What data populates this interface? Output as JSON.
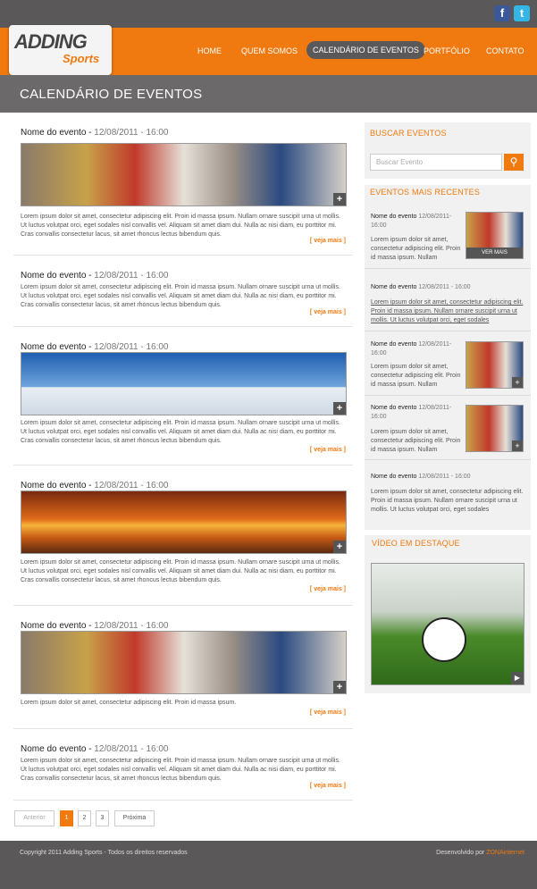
{
  "social": {
    "facebook": "f",
    "twitter": "t"
  },
  "brand": {
    "line1": "ADDING",
    "line2": "Sports"
  },
  "nav": {
    "home": "HOME",
    "quem": "QUEM SOMOS",
    "calendario": "CALENDÁRIO DE EVENTOS",
    "portfolio": "PORTFÓLIO",
    "contato": "CONTATO"
  },
  "page_title": "CALENDÁRIO DE EVENTOS",
  "events": [
    {
      "name": "Nome do evento - ",
      "date": "12/08/2011 - 16:00",
      "text": "Lorem ipsum dolor sit amet, consectetur adipiscing elit. Proin id massa ipsum. Nullam ornare suscipit urna ut mollis. Ut luctus volutpat orci, eget sodales nisl convallis vel. Aliquam sit amet diam dui. Nulla ac nisi diam, eu porttitor mi. Cras convallis consectetur lacus, sit amet rhoncus lectus bibendum quis.",
      "more": "[ veja mais ]"
    },
    {
      "name": "Nome do evento - ",
      "date": "12/08/2011 - 16:00",
      "text": "Lorem ipsum dolor sit amet, consectetur adipiscing elit. Proin id massa ipsum. Nullam ornare suscipit urna ut mollis. Ut luctus volutpat orci, eget sodales nisl convallis vel. Aliquam sit amet diam dui. Nulla ac nisi diam, eu porttitor mi. Cras convallis consectetur lacus, sit amet rhoncus lectus bibendum quis.",
      "more": "[ veja mais ]"
    },
    {
      "name": "Nome do evento - ",
      "date": "12/08/2011 - 16:00",
      "text": "Lorem ipsum dolor sit amet, consectetur adipiscing elit. Proin id massa ipsum. Nullam ornare suscipit urna ut mollis. Ut luctus volutpat orci, eget sodales nisl convallis vel. Aliquam sit amet diam dui. Nulla ac nisi diam, eu porttitor mi. Cras convallis consectetur lacus, sit amet rhoncus lectus bibendum quis.",
      "more": "[ veja mais ]"
    },
    {
      "name": "Nome do evento - ",
      "date": "12/08/2011 - 16:00",
      "text": "Lorem ipsum dolor sit amet, consectetur adipiscing elit. Proin id massa ipsum. Nullam ornare suscipit urna ut mollis. Ut luctus volutpat orci, eget sodales nisl convallis vel. Aliquam sit amet diam dui. Nulla ac nisi diam, eu porttitor mi. Cras convallis consectetur lacus, sit amet rhoncus lectus bibendum quis.",
      "more": "[ veja mais ]"
    },
    {
      "name": "Nome do evento - ",
      "date": "12/08/2011 - 16:00",
      "text": "Lorem ipsum dolor sit amet, consectetur adipiscing elit. Proin id massa ipsum.",
      "more": "[ veja mais ]"
    },
    {
      "name": "Nome do evento - ",
      "date": "12/08/2011 - 16:00",
      "text": "Lorem ipsum dolor sit amet, consectetur adipiscing elit. Proin id massa ipsum. Nullam ornare suscipit urna ut mollis. Ut luctus volutpat orci, eget sodales nisl convallis vel. Aliquam sit amet diam dui. Nulla ac nisi diam, eu porttitor mi. Cras convallis consectetur lacus, sit amet rhoncus lectus bibendum quis.",
      "more": "[ veja mais ]"
    }
  ],
  "pagination": {
    "prev": "Anterior",
    "p1": "1",
    "p2": "2",
    "p3": "3",
    "next": "Próxima"
  },
  "sidebar": {
    "search_title": "BUSCAR EVENTOS",
    "search_placeholder": "Buscar Evento",
    "recent_title": "EVENTOS MAIS RECENTES",
    "recent": [
      {
        "name": "Nome do evento",
        "date": " 12/08/2011- 16:00",
        "text": "Lorem ipsum dolor sit amet, consectetur adipiscing elit. Proin id massa ipsum. Nullam",
        "badge": "VER MAIS"
      },
      {
        "name": "Nome do evento",
        "date": " 12/08/2011 - 16:00",
        "text": "Lorem ipsum dolor sit amet, consectetur adipiscing elit. Proin id massa ipsum. Nullam ornare suscipit urna ut mollis. Ut luctus volutpat orci, eget sodales"
      },
      {
        "name": "Nome do evento",
        "date": " 12/08/2011- 16:00",
        "text": "Lorem ipsum dolor sit amet, consectetur adipiscing elit. Proin id massa ipsum. Nullam"
      },
      {
        "name": "Nome do evento",
        "date": " 12/08/2011- 16:00",
        "text": "Lorem ipsum dolor sit amet, consectetur adipiscing elit. Proin id massa ipsum. Nullam"
      },
      {
        "name": "Nome do evento",
        "date": " 12/08/2011 - 16:00",
        "text": "Lorem ipsum dolor sit amet, consectetur adipiscing elit. Proin id massa ipsum. Nullam ornare suscipit urna ut mollis. Ut luctus volutpat orci, eget sodales"
      }
    ],
    "video_title": "VÍDEO EM DESTAQUE"
  },
  "footer": {
    "copyright": "Copyright 2011 Adding Sports - Todos os direitos reservados",
    "dev": "Desenvolvido por ",
    "dev_brand": "ZONAinternet"
  },
  "colors": {
    "accent": "#f07a10",
    "dark": "#5a5859"
  }
}
